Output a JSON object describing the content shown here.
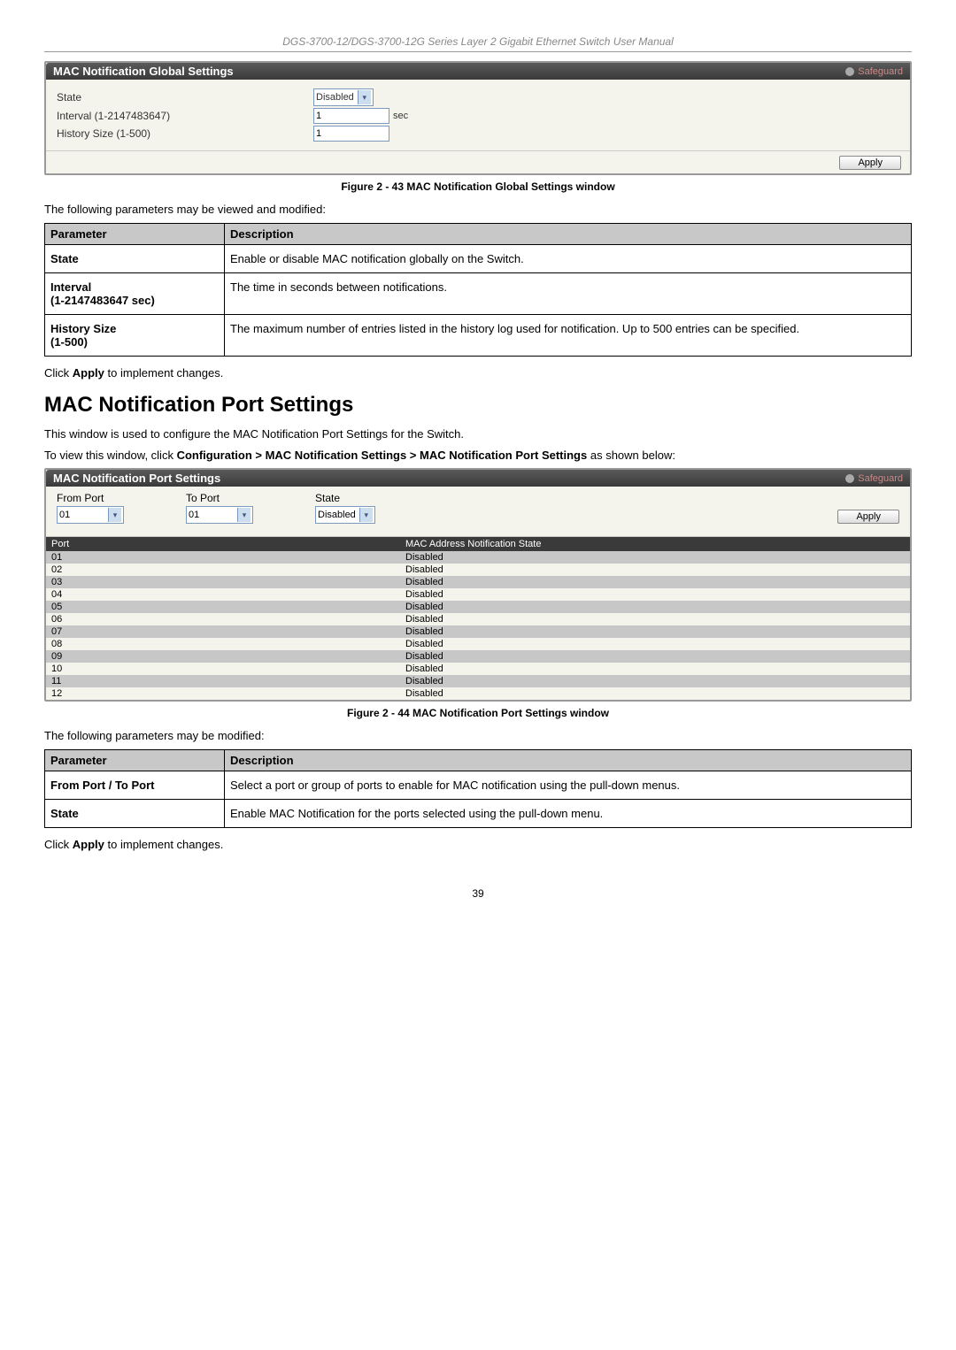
{
  "manual_header": "DGS-3700-12/DGS-3700-12G Series Layer 2 Gigabit Ethernet Switch User Manual",
  "page_number": "39",
  "panel1": {
    "title": "MAC Notification Global Settings",
    "safeguard": "Safeguard",
    "state_label": "State",
    "state_value": "Disabled",
    "interval_label": "Interval (1-2147483647)",
    "interval_value": "1",
    "interval_unit": "sec",
    "history_label": "History Size (1-500)",
    "history_value": "1",
    "apply": "Apply"
  },
  "caption1": "Figure 2 - 43 MAC Notification Global Settings window",
  "text1": "The following parameters may be viewed and modified:",
  "table1": {
    "h1": "Parameter",
    "h2": "Description",
    "rows": [
      {
        "p": "State",
        "d": "Enable or disable MAC notification globally on the Switch."
      },
      {
        "p": "Interval\n(1-2147483647 sec)",
        "d": "The time in seconds between notifications."
      },
      {
        "p": "History Size\n(1-500)",
        "d": "The maximum number of entries listed in the history log used for notification. Up to 500 entries can be specified."
      }
    ]
  },
  "text2a": "Click ",
  "text2b": "Apply",
  "text2c": " to implement changes.",
  "section_title": "MAC Notification Port Settings",
  "text3": "This window is used to configure the MAC Notification Port Settings for the Switch.",
  "text4a": "To view this window, click ",
  "text4b": "Configuration > MAC Notification Settings > MAC Notification Port Settings",
  "text4c": " as shown below:",
  "panel2": {
    "title": "MAC Notification Port Settings",
    "safeguard": "Safeguard",
    "from_port_label": "From Port",
    "from_port_value": "01",
    "to_port_label": "To Port",
    "to_port_value": "01",
    "state_label": "State",
    "state_value": "Disabled",
    "apply": "Apply",
    "col1": "Port",
    "col2": "MAC Address Notification State",
    "rows": [
      {
        "port": "01",
        "state": "Disabled"
      },
      {
        "port": "02",
        "state": "Disabled"
      },
      {
        "port": "03",
        "state": "Disabled"
      },
      {
        "port": "04",
        "state": "Disabled"
      },
      {
        "port": "05",
        "state": "Disabled"
      },
      {
        "port": "06",
        "state": "Disabled"
      },
      {
        "port": "07",
        "state": "Disabled"
      },
      {
        "port": "08",
        "state": "Disabled"
      },
      {
        "port": "09",
        "state": "Disabled"
      },
      {
        "port": "10",
        "state": "Disabled"
      },
      {
        "port": "11",
        "state": "Disabled"
      },
      {
        "port": "12",
        "state": "Disabled"
      }
    ]
  },
  "caption2": "Figure 2 - 44 MAC Notification Port Settings window",
  "text5": "The following parameters may be modified:",
  "table2": {
    "h1": "Parameter",
    "h2": "Description",
    "rows": [
      {
        "p": "From Port / To Port",
        "d": "Select a port or group of ports to enable for MAC notification using the pull-down menus."
      },
      {
        "p": "State",
        "d": "Enable MAC Notification for the ports selected using the pull-down menu."
      }
    ]
  }
}
